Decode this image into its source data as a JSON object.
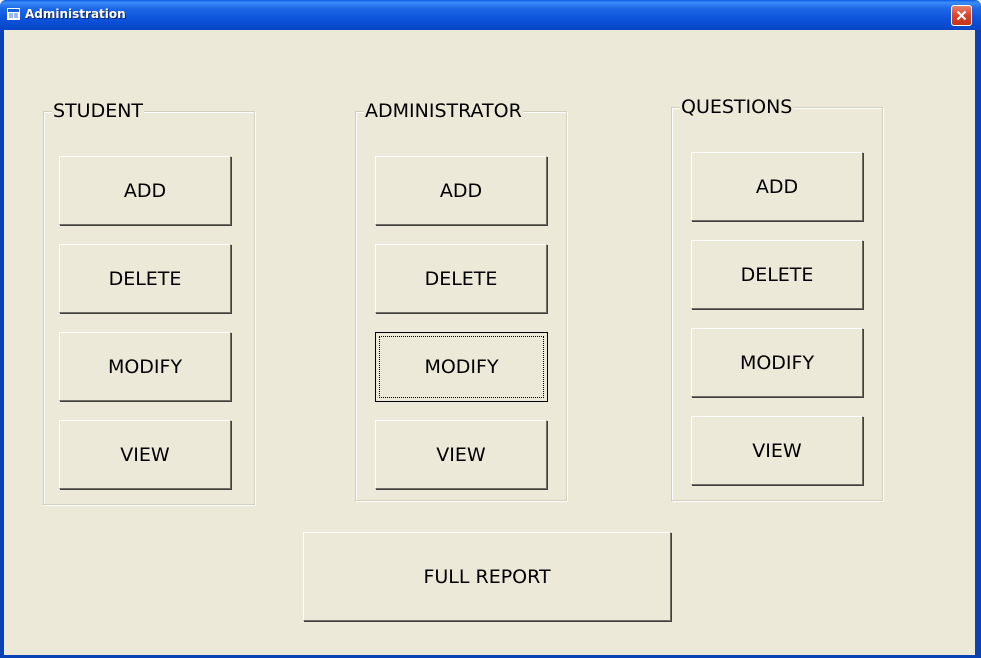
{
  "window": {
    "title": "Administration"
  },
  "groups": {
    "student": {
      "label": "STUDENT",
      "add": "ADD",
      "delete": "DELETE",
      "modify": "MODIFY",
      "view": "VIEW"
    },
    "administrator": {
      "label": "ADMINISTRATOR",
      "add": "ADD",
      "delete": "DELETE",
      "modify": "MODIFY",
      "view": "VIEW"
    },
    "questions": {
      "label": "QUESTIONS",
      "add": "ADD",
      "delete": "DELETE",
      "modify": "MODIFY",
      "view": "VIEW"
    }
  },
  "full_report": "FULL REPORT",
  "colors": {
    "titlebar": "#0a50d8",
    "client": "#ece9d8",
    "close": "#d8452a"
  },
  "icons": {
    "app": "app-icon",
    "close": "close-icon"
  }
}
